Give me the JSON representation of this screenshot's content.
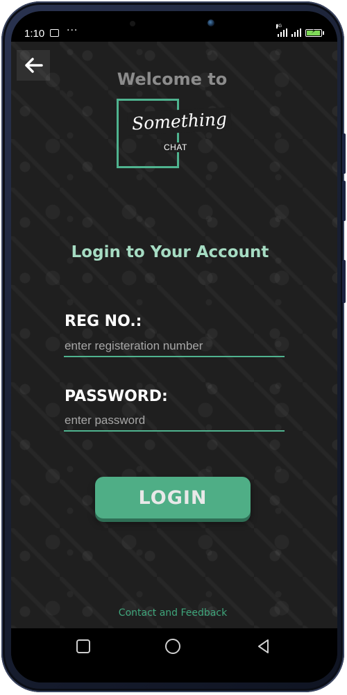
{
  "status_bar": {
    "time": "1:10",
    "image_icon": "image-icon",
    "more_icon": "more-dots-icon",
    "more_text": "···",
    "network_label": "4G",
    "signal_icon": "signal-icon",
    "battery_icon": "battery-charging-icon"
  },
  "header": {
    "back_icon": "arrow-left-icon",
    "welcome": "Welcome to"
  },
  "logo": {
    "title": "Something",
    "subtitle": "CHAT"
  },
  "login": {
    "heading": "Login to Your Account",
    "reg_label": "REG NO.:",
    "reg_placeholder": "enter registeration number",
    "reg_value": "",
    "password_label": "PASSWORD:",
    "password_placeholder": "enter password",
    "password_value": "",
    "button_label": "LOGIN"
  },
  "footer": {
    "contact": "Contact and Feedback"
  },
  "nav": {
    "recents_icon": "square-recents-icon",
    "home_icon": "circle-home-icon",
    "back_icon": "triangle-back-icon"
  },
  "colors": {
    "accent": "#4fae86",
    "heading": "#a6dcc3",
    "welcome": "#8c8c8c",
    "background": "#1f1f1f"
  }
}
